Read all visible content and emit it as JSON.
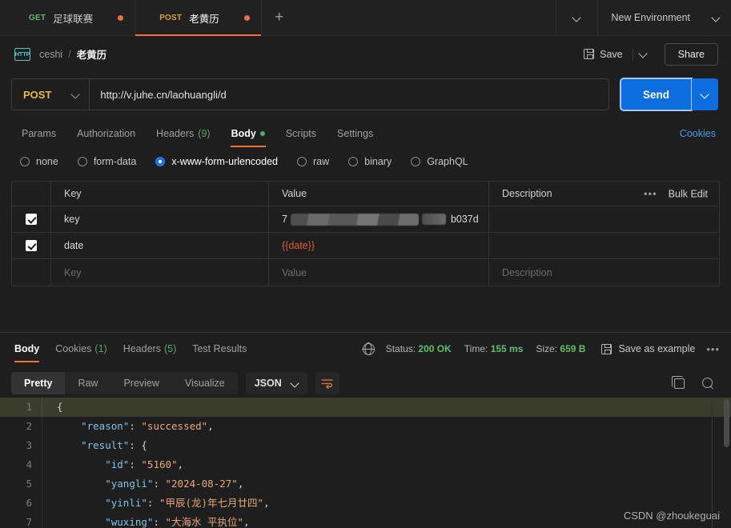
{
  "tabbar": {
    "tabs": [
      {
        "verb": "GET",
        "name": "足球联赛",
        "unsaved": true,
        "active": false
      },
      {
        "verb": "POST",
        "name": "老黄历",
        "unsaved": true,
        "active": true
      }
    ],
    "new_tab_label": "+",
    "environment": "New Environment"
  },
  "breadcrumb": {
    "icon_label": "HTTP",
    "collection": "ceshi",
    "separator": "/",
    "request": "老黄历",
    "save_label": "Save",
    "share_label": "Share"
  },
  "url_bar": {
    "method": "POST",
    "url": "http://v.juhe.cn/laohuangli/d",
    "send_label": "Send"
  },
  "request_tabs": {
    "items": [
      {
        "label": "Params",
        "active": false
      },
      {
        "label": "Authorization",
        "active": false
      },
      {
        "label": "Headers",
        "count": "(9)",
        "active": false
      },
      {
        "label": "Body",
        "dot": true,
        "active": true
      },
      {
        "label": "Scripts",
        "active": false
      },
      {
        "label": "Settings",
        "active": false
      }
    ],
    "cookies_label": "Cookies"
  },
  "body_type": {
    "options": [
      {
        "label": "none",
        "selected": false
      },
      {
        "label": "form-data",
        "selected": false
      },
      {
        "label": "x-www-form-urlencoded",
        "selected": true
      },
      {
        "label": "raw",
        "selected": false
      },
      {
        "label": "binary",
        "selected": false
      },
      {
        "label": "GraphQL",
        "selected": false
      }
    ]
  },
  "kv_table": {
    "headers": {
      "key": "Key",
      "value": "Value",
      "description": "Description"
    },
    "bulk_edit_label": "Bulk Edit",
    "rows": [
      {
        "checked": true,
        "key": "key",
        "value_prefix": "7",
        "value_suffix": "b037d",
        "redacted": true,
        "description": ""
      },
      {
        "checked": true,
        "key": "date",
        "value": "{{date}}",
        "variable": true,
        "description": ""
      }
    ],
    "placeholder_row": {
      "key": "Key",
      "value": "Value",
      "description": "Description"
    }
  },
  "response": {
    "tabs": [
      {
        "label": "Body",
        "active": true
      },
      {
        "label": "Cookies",
        "count": "(1)",
        "active": false
      },
      {
        "label": "Headers",
        "count": "(5)",
        "active": false
      },
      {
        "label": "Test Results",
        "active": false
      }
    ],
    "status_label": "Status:",
    "status_value": "200 OK",
    "time_label": "Time:",
    "time_value": "155 ms",
    "size_label": "Size:",
    "size_value": "659 B",
    "save_example_label": "Save as example",
    "view_tabs": [
      {
        "label": "Pretty",
        "active": true
      },
      {
        "label": "Raw",
        "active": false
      },
      {
        "label": "Preview",
        "active": false
      },
      {
        "label": "Visualize",
        "active": false
      }
    ],
    "format": "JSON"
  },
  "code": {
    "lines": [
      {
        "n": "1",
        "highlight": true,
        "tokens": [
          {
            "t": "punc",
            "s": "{"
          }
        ]
      },
      {
        "n": "2",
        "highlight": false,
        "tokens": [
          {
            "t": "punc",
            "s": "    "
          },
          {
            "t": "key",
            "s": "\"reason\""
          },
          {
            "t": "punc",
            "s": ": "
          },
          {
            "t": "str",
            "s": "\"successed\""
          },
          {
            "t": "punc",
            "s": ","
          }
        ]
      },
      {
        "n": "3",
        "highlight": false,
        "tokens": [
          {
            "t": "punc",
            "s": "    "
          },
          {
            "t": "key",
            "s": "\"result\""
          },
          {
            "t": "punc",
            "s": ": {"
          }
        ]
      },
      {
        "n": "4",
        "highlight": false,
        "tokens": [
          {
            "t": "punc",
            "s": "        "
          },
          {
            "t": "key",
            "s": "\"id\""
          },
          {
            "t": "punc",
            "s": ": "
          },
          {
            "t": "str",
            "s": "\"5160\""
          },
          {
            "t": "punc",
            "s": ","
          }
        ]
      },
      {
        "n": "5",
        "highlight": false,
        "tokens": [
          {
            "t": "punc",
            "s": "        "
          },
          {
            "t": "key",
            "s": "\"yangli\""
          },
          {
            "t": "punc",
            "s": ": "
          },
          {
            "t": "str",
            "s": "\"2024-08-27\""
          },
          {
            "t": "punc",
            "s": ","
          }
        ]
      },
      {
        "n": "6",
        "highlight": false,
        "tokens": [
          {
            "t": "punc",
            "s": "        "
          },
          {
            "t": "key",
            "s": "\"yinli\""
          },
          {
            "t": "punc",
            "s": ": "
          },
          {
            "t": "str",
            "s": "\"甲辰(龙)年七月廿四\""
          },
          {
            "t": "punc",
            "s": ","
          }
        ]
      },
      {
        "n": "7",
        "highlight": false,
        "tokens": [
          {
            "t": "punc",
            "s": "        "
          },
          {
            "t": "key",
            "s": "\"wuxing\""
          },
          {
            "t": "punc",
            "s": ": "
          },
          {
            "t": "str",
            "s": "\"大海水 平执位\""
          },
          {
            "t": "punc",
            "s": ","
          }
        ]
      }
    ]
  },
  "watermark": "CSDN @zhoukeguai"
}
